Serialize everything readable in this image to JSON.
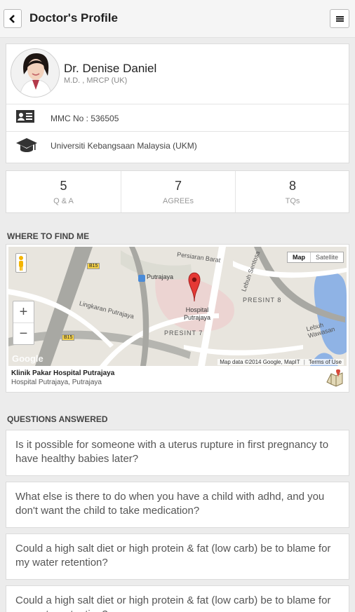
{
  "header": {
    "title": "Doctor's Profile",
    "back_icon": "chevron-left-icon",
    "menu_icon": "hamburger-menu-icon"
  },
  "profile": {
    "name": "Dr. Denise Daniel",
    "qualifications": "M.D. , MRCP (UK)",
    "mmc": "MMC No : 536505",
    "university": "Universiti Kebangsaan Malaysia (UKM)",
    "mmc_icon": "id-card-icon",
    "university_icon": "graduation-cap-icon"
  },
  "stats": [
    {
      "value": "5",
      "label": "Q & A"
    },
    {
      "value": "7",
      "label": "AGREEs"
    },
    {
      "value": "8",
      "label": "TQs"
    }
  ],
  "location": {
    "section_title": "WHERE TO FIND ME",
    "map_toggle": [
      "Map",
      "Satellite"
    ],
    "zoom_in": "+",
    "zoom_out": "−",
    "map_attribution": "Map data ©2014 Google, MapIT",
    "terms": "Terms of Use",
    "google_watermark": "Google",
    "map_labels": {
      "putrajaya": "Putrajaya",
      "hospital": "Hospital Putrajaya",
      "presint7": "PRESINT 7",
      "presint8": "PRESINT 8",
      "lingkaran": "Lingkaran Putrajaya",
      "persiaran": "Persiaran Barat",
      "sentosa": "Lebuh Sentosa",
      "wawasan": "Lebuh Wawasan",
      "b15a": "B15",
      "b15b": "B15"
    },
    "clinic_name": "Klinik Pakar Hospital Putrajaya",
    "clinic_address": "Hospital Putrajaya, Putrajaya",
    "directions_icon": "map-directions-icon"
  },
  "questions": {
    "section_title": "QUESTIONS ANSWERED",
    "items": [
      "Is it possible for someone with a uterus rupture in first pregnancy to have healthy babies later?",
      "What else is there to do when you have a child with adhd, and you don't want the child to take medication?",
      "Could a high salt diet or high protein & fat (low carb) be to blame for my water retention?",
      "Could a high salt diet or high protein & fat (low carb) be to blame for my water retention?"
    ]
  }
}
